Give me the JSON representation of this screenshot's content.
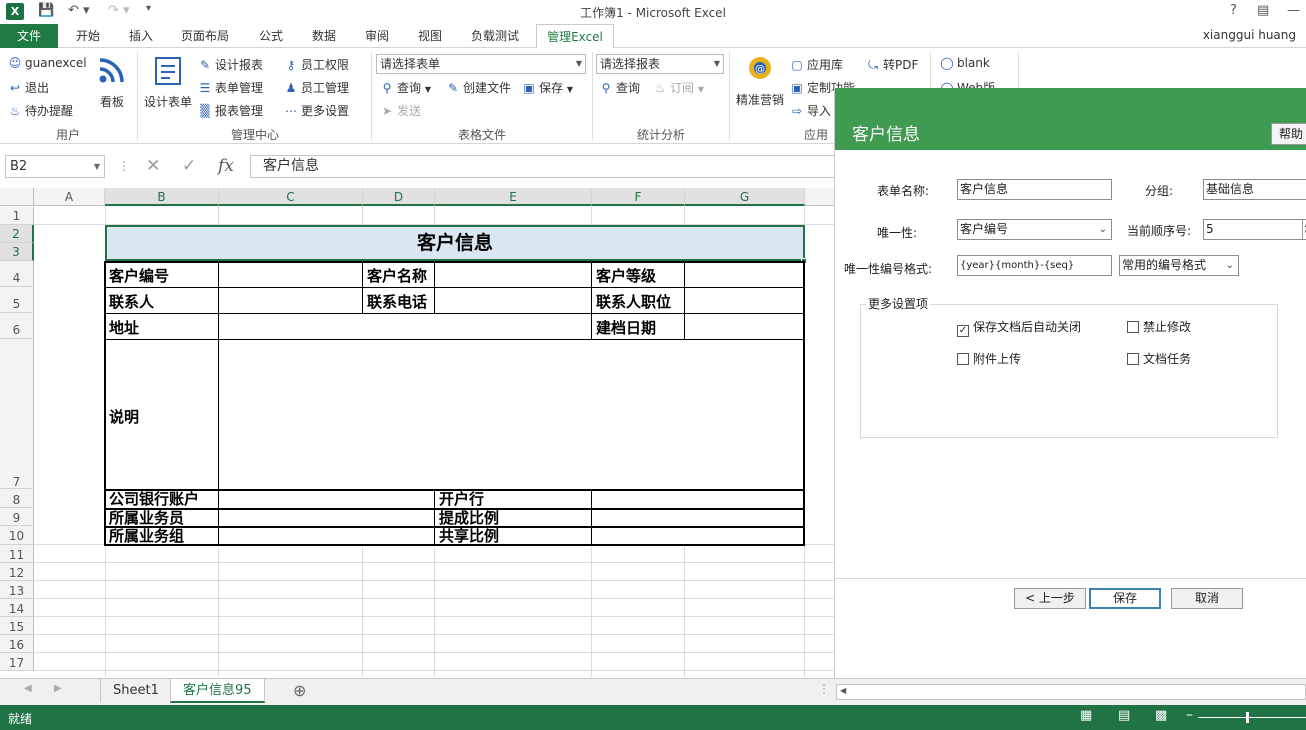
{
  "window": {
    "title": "工作簿1 - Microsoft Excel",
    "help": "?",
    "user": "xianggui huang"
  },
  "tabs": [
    "文件",
    "开始",
    "插入",
    "页面布局",
    "公式",
    "数据",
    "审阅",
    "视图",
    "负载测试",
    "管理Excel"
  ],
  "ribbon": {
    "user_group": {
      "label": "用户",
      "items": [
        "guanexcel",
        "退出",
        "待办提醒"
      ],
      "board": "看板"
    },
    "manage_group": {
      "label": "管理中心",
      "design_form": "设计表单",
      "items": [
        "设计报表",
        "表单管理",
        "报表管理",
        "员工权限",
        "员工管理",
        "更多设置"
      ]
    },
    "form_files_group": {
      "label": "表格文件",
      "select_placeholder": "请选择表单",
      "query": "查询",
      "create": "创建文件",
      "save": "保存",
      "send": "发送"
    },
    "stats_group": {
      "label": "统计分析",
      "select_placeholder": "请选择报表",
      "query": "查询",
      "subscribe": "订阅"
    },
    "app_group": {
      "label": "应用",
      "marketing": "精准营销",
      "items": [
        "应用库",
        "定制功能",
        "导入",
        "转PDF",
        "blank",
        "Web版"
      ]
    }
  },
  "formula_bar": {
    "name_box": "B2",
    "formula": "客户信息",
    "fx": "fx"
  },
  "grid": {
    "columns": [
      "A",
      "B",
      "C",
      "D",
      "E",
      "F",
      "G"
    ],
    "rows": [
      "1",
      "2",
      "3",
      "4",
      "5",
      "6",
      "7",
      "8",
      "9",
      "10",
      "11",
      "12",
      "13",
      "14",
      "15",
      "16",
      "17"
    ],
    "form_title": "客户信息",
    "labels": {
      "customer_no": "客户编号",
      "customer_name": "客户名称",
      "customer_level": "客户等级",
      "contact": "联系人",
      "contact_phone": "联系电话",
      "contact_title": "联系人职位",
      "address": "地址",
      "file_date": "建档日期",
      "description": "说明",
      "bank_account": "公司银行账户",
      "bank": "开户行",
      "salesperson": "所属业务员",
      "commission": "提成比例",
      "sales_group": "所属业务组",
      "share_ratio": "共享比例"
    }
  },
  "sheets": {
    "tabs": [
      "Sheet1",
      "客户信息95"
    ],
    "active": "客户信息95"
  },
  "status": {
    "text": "就绪"
  },
  "dialog": {
    "title": "客户信息",
    "help": "帮助",
    "form_name_label": "表单名称:",
    "form_name": "客户信息",
    "group_label": "分组:",
    "group": "基础信息",
    "unique_label": "唯一性:",
    "unique": "客户编号",
    "seq_label": "当前顺序号:",
    "seq": "5",
    "format_label": "唯一性编号格式:",
    "format": "{year}{month}-{seq}",
    "common_format": "常用的编号格式",
    "more_settings": "更多设置项",
    "options": [
      {
        "label": "保存文档后自动关闭",
        "checked": true
      },
      {
        "label": "禁止修改",
        "checked": false
      },
      {
        "label": "附件上传",
        "checked": false
      },
      {
        "label": "文档任务",
        "checked": false
      }
    ],
    "buttons": {
      "prev": "< 上一步",
      "save": "保存",
      "cancel": "取消"
    }
  }
}
